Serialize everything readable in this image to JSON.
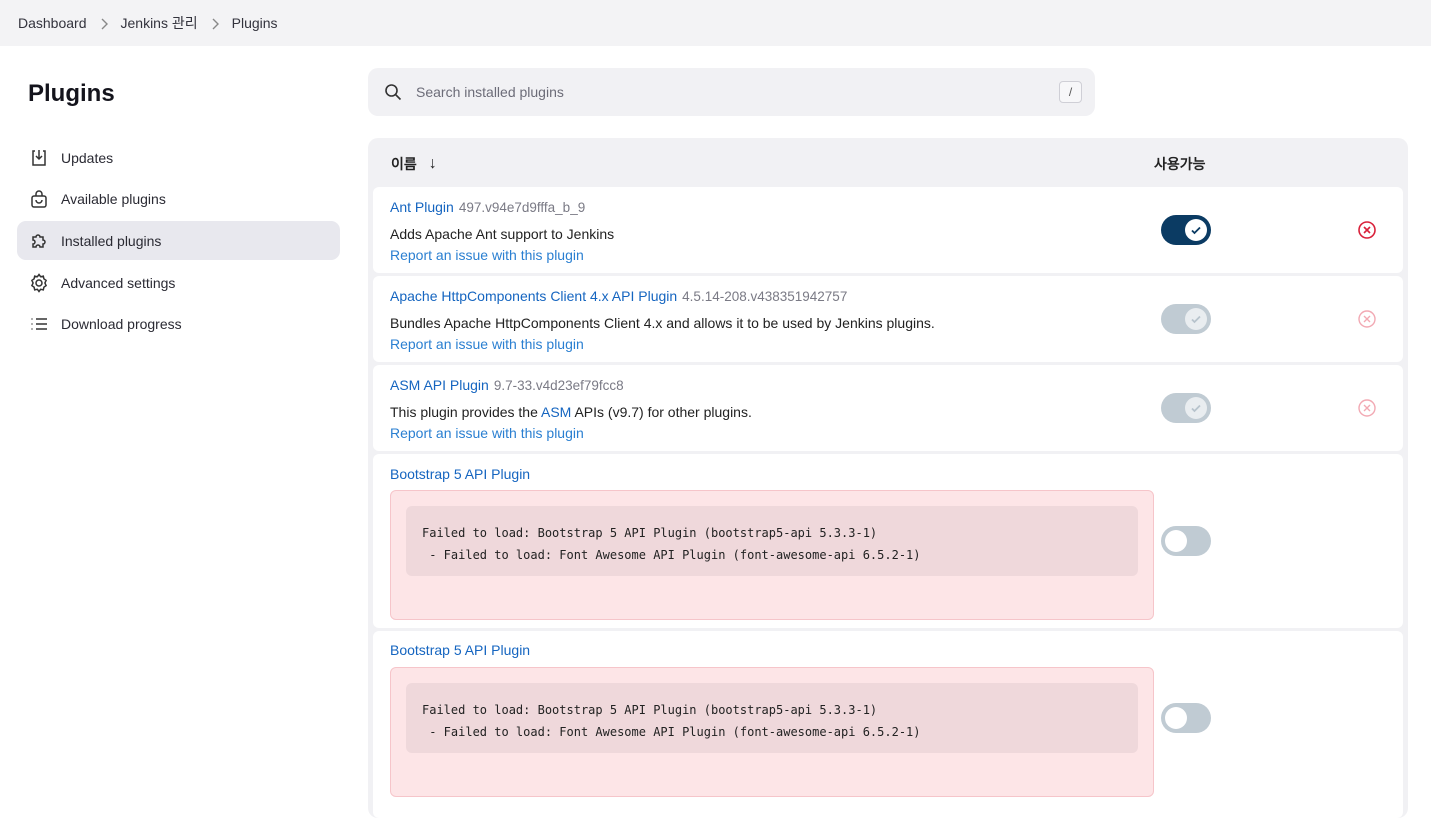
{
  "breadcrumb": {
    "items": [
      "Dashboard",
      "Jenkins 관리",
      "Plugins"
    ]
  },
  "sidebar": {
    "title": "Plugins",
    "items": [
      {
        "label": "Updates",
        "icon": "download-icon",
        "active": false
      },
      {
        "label": "Available plugins",
        "icon": "shopping-bag-icon",
        "active": false
      },
      {
        "label": "Installed plugins",
        "icon": "puzzle-icon",
        "active": true
      },
      {
        "label": "Advanced settings",
        "icon": "gear-icon",
        "active": false
      },
      {
        "label": "Download progress",
        "icon": "list-icon",
        "active": false
      }
    ]
  },
  "search": {
    "placeholder": "Search installed plugins",
    "shortcut": "/"
  },
  "table": {
    "col_name": "이름",
    "sort_arrow": "↓",
    "col_enabled": "사용가능"
  },
  "plugins": [
    {
      "name": "Ant Plugin",
      "version": "497.v94e7d9fffa_b_9",
      "description": "Adds Apache Ant support to Jenkins",
      "report": "Report an issue with this plugin",
      "enabled": true,
      "toggle_state": "on"
    },
    {
      "name": "Apache HttpComponents Client 4.x API Plugin",
      "version": "4.5.14-208.v438351942757",
      "description": "Bundles Apache HttpComponents Client 4.x and allows it to be used by Jenkins plugins.",
      "report": "Report an issue with this plugin",
      "enabled": true,
      "toggle_state": "on-disabled"
    },
    {
      "name": "ASM API Plugin",
      "version": "9.7-33.v4d23ef79fcc8",
      "description_pre": "This plugin provides the ",
      "description_link": "ASM",
      "description_post": " APIs (v9.7) for other plugins.",
      "report": "Report an issue with this plugin",
      "enabled": true,
      "toggle_state": "on-disabled"
    },
    {
      "name": "Bootstrap 5 API Plugin",
      "error_line1": "Failed to load: Bootstrap 5 API Plugin (bootstrap5-api 5.3.3-1)",
      "error_line2": " - Failed to load: Font Awesome API Plugin (font-awesome-api 6.5.2-1)",
      "enabled": false,
      "toggle_state": "off"
    },
    {
      "name": "Bootstrap 5 API Plugin",
      "error_line1": "Failed to load: Bootstrap 5 API Plugin (bootstrap5-api 5.3.3-1)",
      "error_line2": " - Failed to load: Font Awesome API Plugin (font-awesome-api 6.5.2-1)",
      "enabled": false,
      "toggle_state": "off"
    }
  ],
  "colors": {
    "accent": "#0b3b63",
    "link": "#1565c0",
    "error_bg": "#fde5e7",
    "uninstall_red": "#d9213a"
  }
}
